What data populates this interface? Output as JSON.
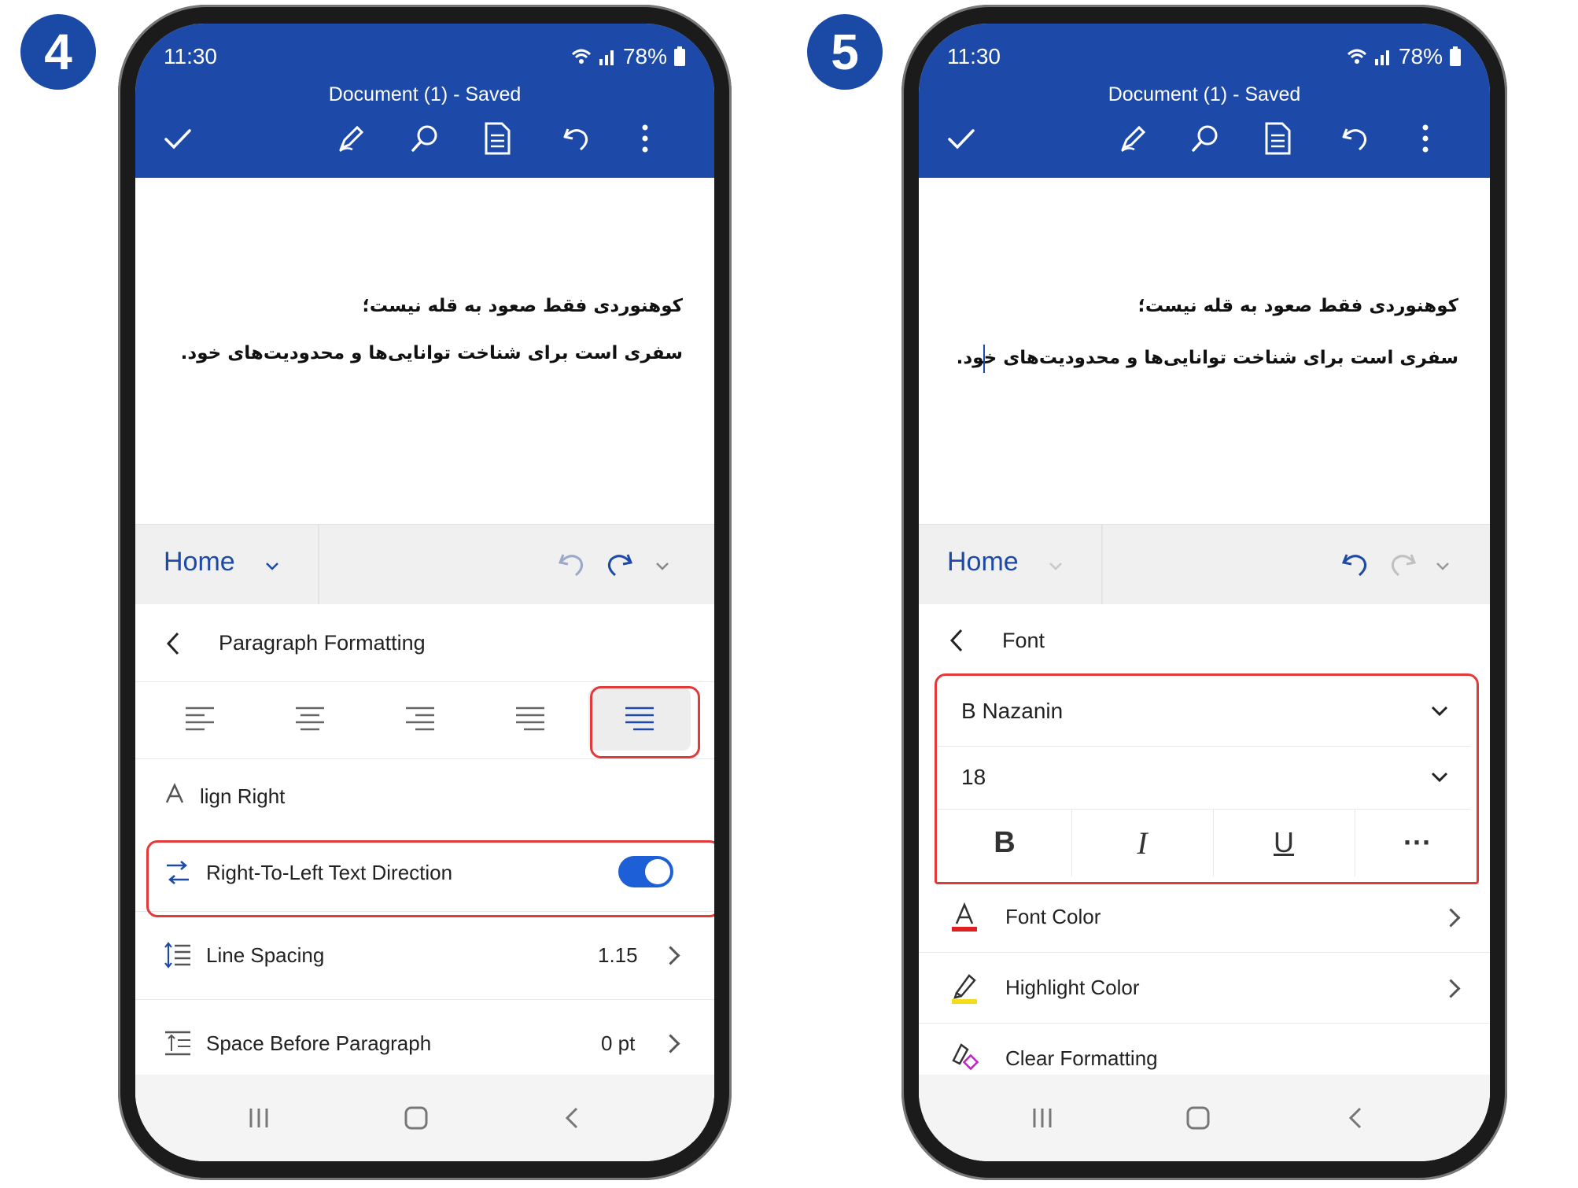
{
  "colors": {
    "accent": "#1d4aa8",
    "highlight_box": "#e23a3a",
    "toggle_on": "#1d5fd6"
  },
  "steps": [
    {
      "number": "4"
    },
    {
      "number": "5"
    }
  ],
  "phone1": {
    "status": {
      "time": "11:30",
      "battery": "78%"
    },
    "app_title": "Document (1) - Saved",
    "doc_lines": [
      "کوهنوردی فقط صعود به قله نیست؛",
      "سفری است برای شناخت توانایی‌ها و محدودیت‌های خود."
    ],
    "ribbon": {
      "tab_label": "Home"
    },
    "panel_title": "Paragraph Formatting",
    "align_hint": "lign Right",
    "rtl_option": {
      "label": "Right-To-Left Text Direction",
      "enabled": true
    },
    "line_spacing": {
      "label": "Line Spacing",
      "value": "1.15"
    },
    "space_before": {
      "label": "Space Before Paragraph",
      "value": "0 pt"
    }
  },
  "phone2": {
    "status": {
      "time": "11:30",
      "battery": "78%"
    },
    "app_title": "Document (1) - Saved",
    "doc_lines": [
      "کوهنوردی فقط صعود به قله نیست؛",
      "سفری است برای شناخت توانایی‌ها و محدودیت‌های خود."
    ],
    "ribbon": {
      "tab_label": "Home"
    },
    "panel_title": "Font",
    "font_name": "B  Nazanin",
    "font_size": "18",
    "style_buttons": {
      "bold": "B",
      "italic": "I",
      "underline": "U",
      "more": "···"
    },
    "font_color_label": "Font Color",
    "highlight_color_label": "Highlight Color",
    "clear_formatting_label": "Clear Formatting"
  }
}
